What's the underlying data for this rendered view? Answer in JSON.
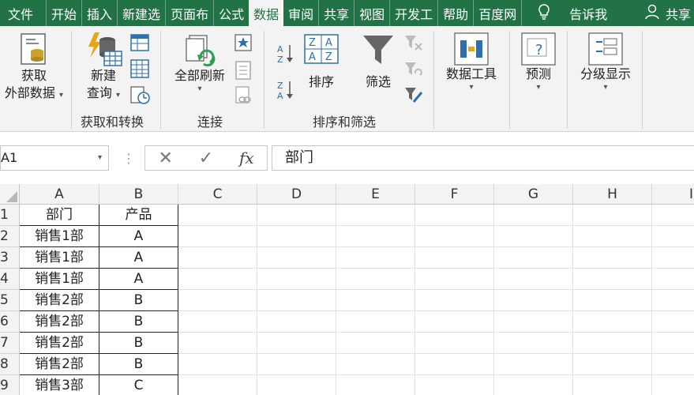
{
  "tabs": [
    {
      "label": "文件"
    },
    {
      "label": "开始"
    },
    {
      "label": "插入"
    },
    {
      "label": "新建选"
    },
    {
      "label": "页面布"
    },
    {
      "label": "公式"
    },
    {
      "label": "数据",
      "active": true
    },
    {
      "label": "审阅"
    },
    {
      "label": "共享"
    },
    {
      "label": "视图"
    },
    {
      "label": "开发工"
    },
    {
      "label": "帮助"
    },
    {
      "label": "百度网"
    }
  ],
  "tellme": "告诉我",
  "share": "共享",
  "ribbon": {
    "get_external": [
      "获取",
      "外部数据"
    ],
    "new_query": [
      "新建",
      "查询"
    ],
    "refresh_all": "全部刷新",
    "sort": "排序",
    "filter": "筛选",
    "data_tools": "数据工具",
    "forecast": "预测",
    "outline": "分级显示",
    "groups": {
      "get_transform": "获取和转换",
      "connections": "连接",
      "sort_filter": "排序和筛选"
    }
  },
  "formula_bar": {
    "name_box": "A1",
    "fx": "fx",
    "value": "部门"
  },
  "columns": [
    "A",
    "B",
    "C",
    "D",
    "E",
    "F",
    "G",
    "H",
    "I"
  ],
  "rows": [
    "1",
    "2",
    "3",
    "4",
    "5",
    "6",
    "7",
    "8",
    "9"
  ],
  "table": [
    [
      "部门",
      "产品"
    ],
    [
      "销售1部",
      "A"
    ],
    [
      "销售1部",
      "A"
    ],
    [
      "销售1部",
      "A"
    ],
    [
      "销售2部",
      "B"
    ],
    [
      "销售2部",
      "B"
    ],
    [
      "销售2部",
      "B"
    ],
    [
      "销售2部",
      "B"
    ],
    [
      "销售3部",
      "C"
    ]
  ],
  "colors": {
    "brand": "#217346",
    "ribbon_bg": "#f3f3f3"
  }
}
